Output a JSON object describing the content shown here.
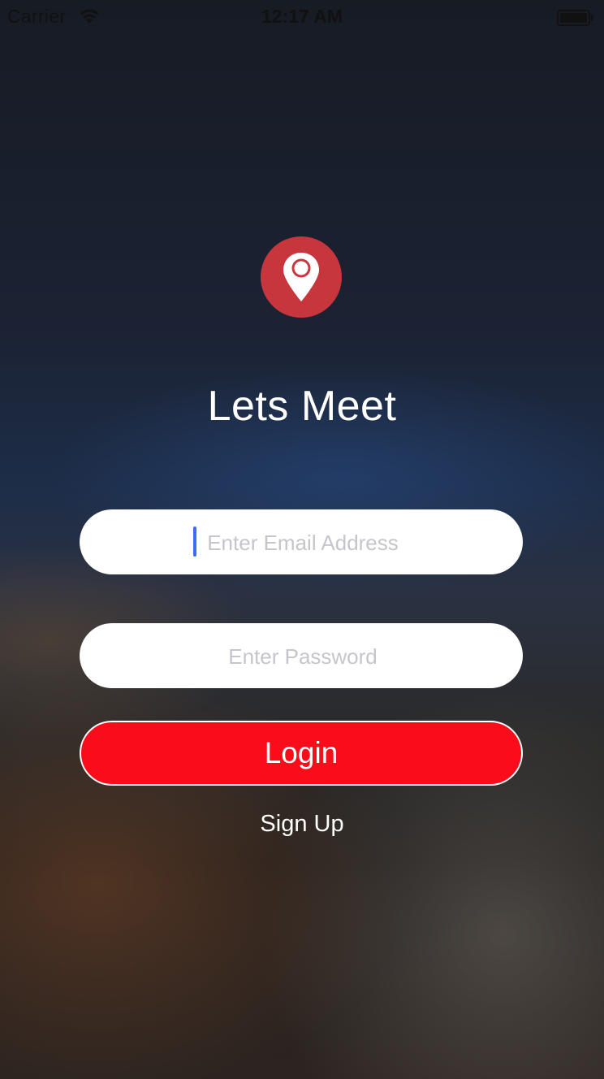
{
  "status_bar": {
    "carrier": "Carrier",
    "time": "12:17 AM",
    "wifi_icon": "wifi-icon",
    "battery_icon": "battery-icon"
  },
  "logo": {
    "icon": "location-pin-icon",
    "background_color": "#c8363d"
  },
  "app_title": "Lets Meet",
  "form": {
    "email_placeholder": "Enter Email Address",
    "email_value": "",
    "password_placeholder": "Enter Password",
    "password_value": "",
    "login_label": "Login",
    "login_color": "#fb0c1a",
    "signup_label": "Sign Up"
  }
}
